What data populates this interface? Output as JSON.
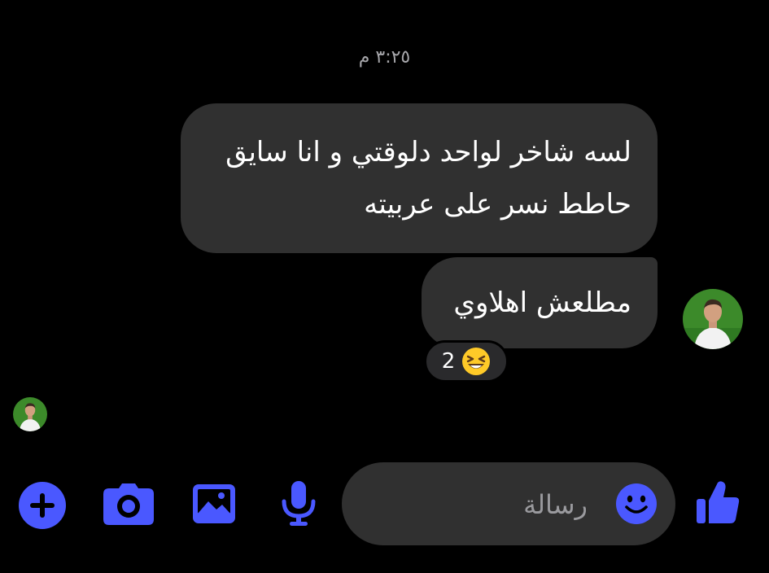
{
  "thread": {
    "timestamp": "٣:٢٥ م"
  },
  "messages": [
    {
      "lines": [
        "لسه شاخر لواحد دلوقتي و انا سايق",
        "حاطط نسر على عربيته"
      ]
    },
    {
      "text": "مطلعش اهلاوي",
      "reaction": {
        "emoji": "grinning-squinting-face",
        "count": "2"
      }
    }
  ],
  "composer": {
    "placeholder": "رسالة"
  },
  "icons": {
    "add": "plus-circle-icon",
    "camera": "camera-icon",
    "gallery": "image-icon",
    "voice": "microphone-icon",
    "emoji": "smile-icon",
    "like": "thumbs-up-icon"
  },
  "colors": {
    "background": "#000000",
    "bubble": "#303030",
    "accent": "#4a58ff",
    "timestamp": "#a7a7ab"
  }
}
